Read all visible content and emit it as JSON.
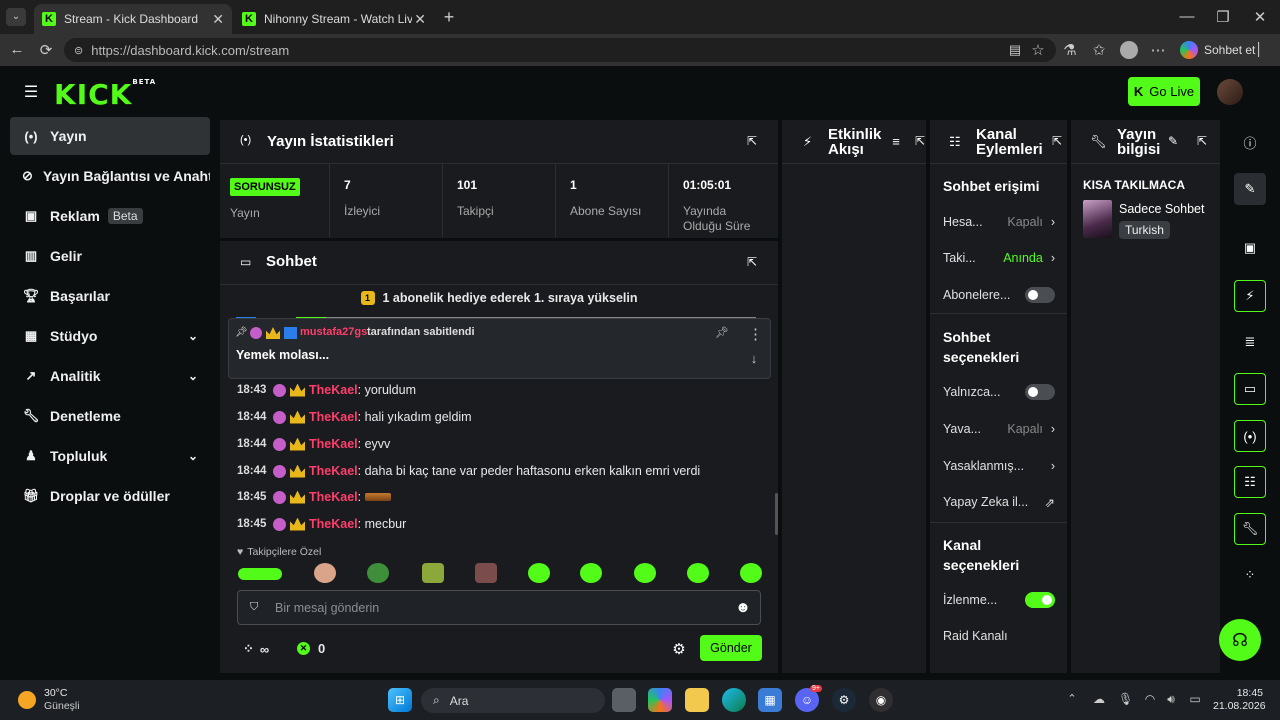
{
  "browser": {
    "tabs": [
      {
        "title": "Stream - Kick Dashboard",
        "active": true
      },
      {
        "title": "Nihonny Stream - Watch Live on K",
        "active": false
      }
    ],
    "url": "https://dashboard.kick.com/stream",
    "copilot_label": "Sohbet et"
  },
  "header": {
    "logo": "KICK",
    "logo_badge": "BETA",
    "go_live_label": "Go Live"
  },
  "sidebar": {
    "items": [
      {
        "label": "Yayın",
        "icon": "broadcast-icon",
        "active": true
      },
      {
        "label": "Yayın Bağlantısı ve Anahtarı",
        "icon": "link-icon"
      },
      {
        "label": "Reklam",
        "icon": "ad-icon",
        "badge": "Beta"
      },
      {
        "label": "Gelir",
        "icon": "chart-icon"
      },
      {
        "label": "Başarılar",
        "icon": "trophy-icon"
      },
      {
        "label": "Stüdyo",
        "icon": "studio-icon",
        "expandable": true
      },
      {
        "label": "Analitik",
        "icon": "analytics-icon",
        "expandable": true
      },
      {
        "label": "Denetleme",
        "icon": "wrench-icon"
      },
      {
        "label": "Topluluk",
        "icon": "community-icon",
        "expandable": true
      },
      {
        "label": "Droplar ve ödüller",
        "icon": "gift-icon"
      }
    ]
  },
  "stats": {
    "title": "Yayın İstatistikleri",
    "status_badge": "SORUNSUZ",
    "status_label": "Yayın",
    "viewers": {
      "value": "7",
      "label": "İzleyici"
    },
    "followers": {
      "value": "101",
      "label": "Takipçi"
    },
    "subs": {
      "value": "1",
      "label": "Abone Sayısı"
    },
    "uptime": {
      "value": "01:05:01",
      "label": "Yayında Olduğu Süre"
    }
  },
  "chat": {
    "title": "Sohbet",
    "gift_banner": "1 abonelik hediye ederek 1. sıraya yükselin",
    "pinned": {
      "user": "mustafa27gs",
      "suffix": "tarafından sabitlendi",
      "text": "Yemek molası..."
    },
    "messages": [
      {
        "time": "18:43",
        "user": "TheKael",
        "text": "yoruldum"
      },
      {
        "time": "18:44",
        "user": "TheKael",
        "text": "hali yıkadım geldim"
      },
      {
        "time": "18:44",
        "user": "TheKael",
        "text": "eyvv"
      },
      {
        "time": "18:44",
        "user": "TheKael",
        "text": "daha bi kaç tane var peder haftasonu erken kalkın emri verdi"
      },
      {
        "time": "18:45",
        "user": "TheKael",
        "text": ""
      },
      {
        "time": "18:45",
        "user": "TheKael",
        "text": "mecbur"
      }
    ],
    "emote_section": "Takipçilere Özel",
    "input_placeholder": "Bir mesaj gönderin",
    "points_infinity": "∞",
    "kick_points": "0",
    "send_label": "Gönder"
  },
  "activity": {
    "title": "Etkinlik Akışı"
  },
  "actions": {
    "title": "Kanal Eylemleri",
    "chat_access": "Sohbet erişimi",
    "rows1": [
      {
        "label": "Hesa...",
        "value": "Kapalı",
        "control": "chevron"
      },
      {
        "label": "Taki...",
        "value": "Anında",
        "control": "chevron",
        "green": true
      },
      {
        "label": "Abonelere...",
        "control": "toggle",
        "on": false
      }
    ],
    "chat_options": "Sohbet seçenekleri",
    "rows2": [
      {
        "label": "Yalnızca...",
        "control": "toggle",
        "on": false
      },
      {
        "label": "Yava...",
        "value": "Kapalı",
        "control": "chevron"
      },
      {
        "label": "Yasaklanmış...",
        "control": "chevron"
      },
      {
        "label": "Yapay Zeka il...",
        "control": "external"
      }
    ],
    "channel_options": "Kanal seçenekleri",
    "rows3": [
      {
        "label": "İzlenme...",
        "control": "toggle",
        "on": true
      },
      {
        "label": "Raid Kanalı",
        "control": "none"
      }
    ]
  },
  "streaminfo": {
    "title": "Yayın bilgisi",
    "stream_title": "KISA TAKILMACA",
    "category": "Sadece Sohbet",
    "language": "Turkish"
  },
  "taskbar": {
    "weather_temp": "30°C",
    "weather_desc": "Güneşli",
    "search_label": "Ara",
    "time": "18:45",
    "date": "21.08.2026",
    "discord_badge": "9+"
  }
}
